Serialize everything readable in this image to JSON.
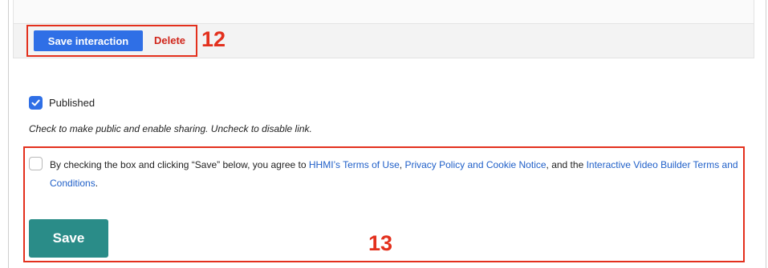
{
  "actions": {
    "save_interaction_label": "Save interaction",
    "delete_label": "Delete"
  },
  "annotations": {
    "label_12": "12",
    "label_13": "13",
    "color": "#e3301d"
  },
  "published": {
    "checked": true,
    "label": "Published",
    "help_text": "Check to make public and enable sharing. Uncheck to disable link."
  },
  "terms": {
    "checked": false,
    "text_before": "By checking the box and clicking “Save” below, you agree to ",
    "link_terms_of_use": "HHMI’s Terms of Use",
    "sep_1": ", ",
    "link_privacy": "Privacy Policy and Cookie Notice",
    "sep_2": ", and the ",
    "link_builder_terms": "Interactive Video Builder Terms and Conditions",
    "text_after": "."
  },
  "form": {
    "save_label": "Save"
  },
  "colors": {
    "primary_blue": "#2f6fe6",
    "delete_red": "#d0251a",
    "link_blue": "#1f5fc8",
    "save_teal": "#2a8c88"
  },
  "icons": {
    "checkmark": "checkmark-icon"
  }
}
